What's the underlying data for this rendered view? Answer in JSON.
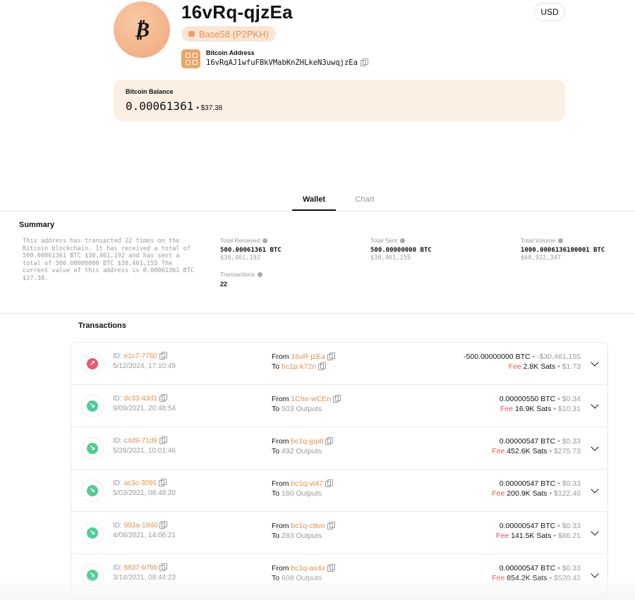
{
  "header": {
    "avatar_glyph": "₿",
    "title": "16vRq-qjzEa",
    "type_pill": "Base58 (P2PKH)",
    "currency": "USD",
    "address_label": "Bitcoin Address",
    "address_full": "16vRqAJ1wfuFBkVMabKnZHLkeN3uwqjzEa"
  },
  "balance": {
    "label": "Bitcoin Balance",
    "btc": "0.00061361",
    "usd": "• $37.38"
  },
  "tabs": [
    {
      "label": "Wallet",
      "active": true
    },
    {
      "label": "Chart",
      "active": false
    }
  ],
  "summary": {
    "title": "Summary",
    "description": "This address has transacted 22 times on the Bitcoin blockchain. It has received a total of 500.00061361 BTC $30,461,192 and has sent a total of 500.00000000 BTC $30,461,155 The current value of this address is 0.00061361 BTC $37.38.",
    "total_received": {
      "label": "Total Received",
      "btc": "500.00061361 BTC",
      "usd": "$30,461,192"
    },
    "total_sent": {
      "label": "Total Sent",
      "btc": "500.00000000 BTC",
      "usd": "$30,461,155"
    },
    "total_volume": {
      "label": "Total Volume",
      "btc": "1000.0006136100001 BTC",
      "usd": "$60,922,347"
    },
    "transactions": {
      "label": "Transactions",
      "value": "22"
    }
  },
  "transactions": {
    "title": "Transactions",
    "rows": [
      {
        "direction": "out",
        "arrow": "↗",
        "id_label": "ID:",
        "id": "e1c7-7760",
        "date": "5/12/2024, 17:10:49",
        "from_label": "From",
        "from": "16vR-jzEa",
        "to_label": "To",
        "to": "bc1p-k72n",
        "to_is_link": true,
        "amount": "-500.00000000 BTC",
        "amount_usd": "• -$30,461,155",
        "fee_label": "Fee",
        "fee": "2.8K Sats",
        "fee_usd": "• $1.73"
      },
      {
        "direction": "in",
        "arrow": "↘",
        "id_label": "ID:",
        "id": "dc33-43d1",
        "date": "9/09/2021, 20:48:54",
        "from_label": "From",
        "from": "1Che-wCEn",
        "to_label": "To",
        "to": "503 Outputs",
        "to_is_link": false,
        "amount": "0.00000550 BTC",
        "amount_usd": "• $0.34",
        "fee_label": "Fee",
        "fee": "16.9K Sats",
        "fee_usd": "• $10.31"
      },
      {
        "direction": "in",
        "arrow": "↘",
        "id_label": "ID:",
        "id": "c4d9-71d9",
        "date": "5/28/2021, 10:01:46",
        "from_label": "From",
        "from": "bc1q-jpp6",
        "to_label": "To",
        "to": "492 Outputs",
        "to_is_link": false,
        "amount": "0.00000547 BTC",
        "amount_usd": "• $0.33",
        "fee_label": "Fee",
        "fee": "452.6K Sats",
        "fee_usd": "• $275.73"
      },
      {
        "direction": "in",
        "arrow": "↘",
        "id_label": "ID:",
        "id": "ac3c-3091",
        "date": "5/03/2021, 08:48:20",
        "from_label": "From",
        "from": "bc1q-vl47",
        "to_label": "To",
        "to": "160 Outputs",
        "to_is_link": false,
        "amount": "0.00000547 BTC",
        "amount_usd": "• $0.33",
        "fee_label": "Fee",
        "fee": "200.9K Sats",
        "fee_usd": "• $122.40"
      },
      {
        "direction": "in",
        "arrow": "↘",
        "id_label": "ID:",
        "id": "993a-1840",
        "date": "4/08/2021, 14:06:21",
        "from_label": "From",
        "from": "bc1q-ctkm",
        "to_label": "To",
        "to": "283 Outputs",
        "to_is_link": false,
        "amount": "0.00000547 BTC",
        "amount_usd": "• $0.33",
        "fee_label": "Fee",
        "fee": "141.5K Sats",
        "fee_usd": "• $86.21"
      },
      {
        "direction": "in",
        "arrow": "↘",
        "id_label": "ID:",
        "id": "8837-b7bb",
        "date": "3/14/2021, 08:44:23",
        "from_label": "From",
        "from": "bc1q-ax4x",
        "to_label": "To",
        "to": "608 Outputs",
        "to_is_link": false,
        "amount": "0.00000547 BTC",
        "amount_usd": "• $0.33",
        "fee_label": "Fee",
        "fee": "854.2K Sats",
        "fee_usd": "• $520.42"
      }
    ]
  }
}
